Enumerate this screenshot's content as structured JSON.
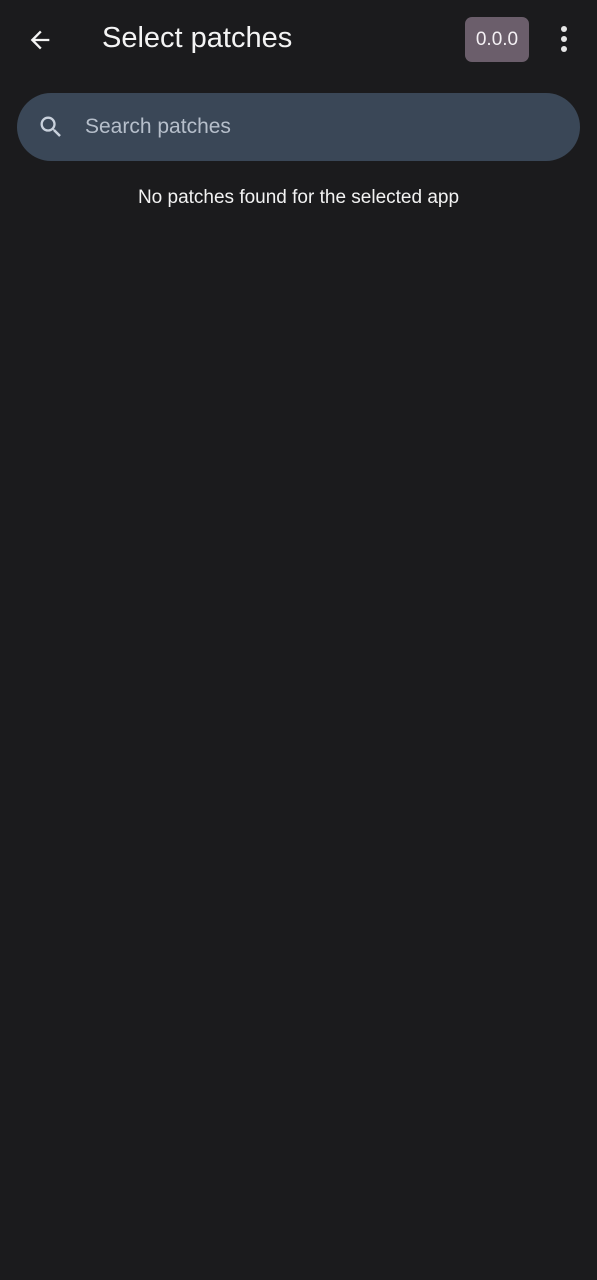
{
  "appbar": {
    "back_icon": "arrow-back-icon",
    "title": "Select patches",
    "version_label": "0.0.0",
    "more_icon": "more-vert-icon"
  },
  "search": {
    "icon": "search-icon",
    "placeholder": "Search patches",
    "value": ""
  },
  "content": {
    "empty_message": "No patches found for the selected app"
  },
  "colors": {
    "background": "#1b1b1d",
    "search_bar": "#3a4757",
    "version_chip": "#6b5e6b",
    "text_primary": "#f2f2f2",
    "placeholder": "#b6bfcb"
  }
}
